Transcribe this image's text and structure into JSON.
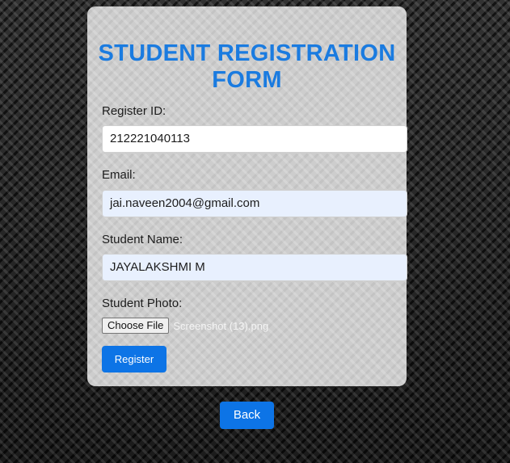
{
  "form": {
    "title": "STUDENT REGISTRATION FORM",
    "register_id": {
      "label": "Register ID:",
      "value": "212221040113"
    },
    "email": {
      "label": "Email:",
      "value": "jai.naveen2004@gmail.com"
    },
    "student_name": {
      "label": "Student Name:",
      "value": "JAYALAKSHMI M"
    },
    "student_photo": {
      "label": "Student Photo:",
      "button_label": "Choose File",
      "file_name": "Screenshot (13).png"
    },
    "register_button": "Register"
  },
  "back_button": "Back",
  "colors": {
    "accent": "#0d74e6",
    "title": "#1a7be0",
    "autofill_bg": "#e8f0fe"
  }
}
